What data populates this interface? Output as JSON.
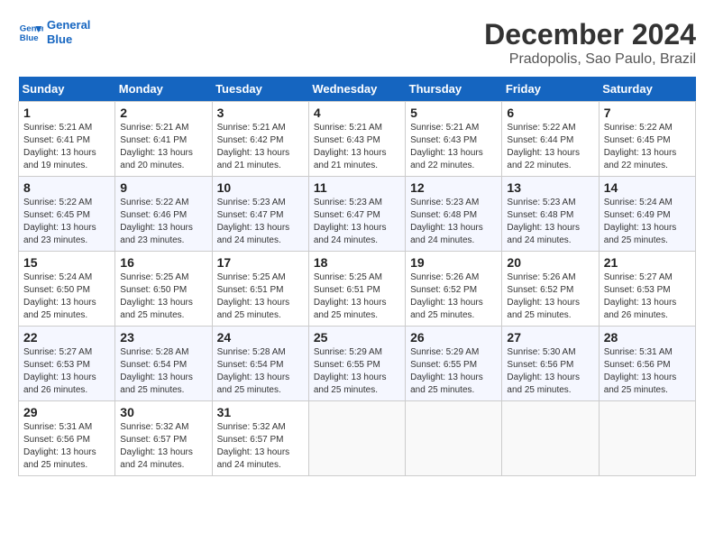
{
  "header": {
    "logo_line1": "General",
    "logo_line2": "Blue",
    "main_title": "December 2024",
    "subtitle": "Pradopolis, Sao Paulo, Brazil"
  },
  "calendar": {
    "days_of_week": [
      "Sunday",
      "Monday",
      "Tuesday",
      "Wednesday",
      "Thursday",
      "Friday",
      "Saturday"
    ],
    "weeks": [
      [
        {
          "day": "",
          "info": ""
        },
        {
          "day": "2",
          "info": "Sunrise: 5:21 AM\nSunset: 6:41 PM\nDaylight: 13 hours\nand 20 minutes."
        },
        {
          "day": "3",
          "info": "Sunrise: 5:21 AM\nSunset: 6:42 PM\nDaylight: 13 hours\nand 21 minutes."
        },
        {
          "day": "4",
          "info": "Sunrise: 5:21 AM\nSunset: 6:43 PM\nDaylight: 13 hours\nand 21 minutes."
        },
        {
          "day": "5",
          "info": "Sunrise: 5:21 AM\nSunset: 6:43 PM\nDaylight: 13 hours\nand 22 minutes."
        },
        {
          "day": "6",
          "info": "Sunrise: 5:22 AM\nSunset: 6:44 PM\nDaylight: 13 hours\nand 22 minutes."
        },
        {
          "day": "7",
          "info": "Sunrise: 5:22 AM\nSunset: 6:45 PM\nDaylight: 13 hours\nand 22 minutes."
        }
      ],
      [
        {
          "day": "1",
          "info": "Sunrise: 5:21 AM\nSunset: 6:41 PM\nDaylight: 13 hours\nand 19 minutes."
        },
        {
          "day": "",
          "info": ""
        },
        {
          "day": "",
          "info": ""
        },
        {
          "day": "",
          "info": ""
        },
        {
          "day": "",
          "info": ""
        },
        {
          "day": "",
          "info": ""
        },
        {
          "day": "",
          "info": ""
        }
      ],
      [
        {
          "day": "8",
          "info": "Sunrise: 5:22 AM\nSunset: 6:45 PM\nDaylight: 13 hours\nand 23 minutes."
        },
        {
          "day": "9",
          "info": "Sunrise: 5:22 AM\nSunset: 6:46 PM\nDaylight: 13 hours\nand 23 minutes."
        },
        {
          "day": "10",
          "info": "Sunrise: 5:23 AM\nSunset: 6:47 PM\nDaylight: 13 hours\nand 24 minutes."
        },
        {
          "day": "11",
          "info": "Sunrise: 5:23 AM\nSunset: 6:47 PM\nDaylight: 13 hours\nand 24 minutes."
        },
        {
          "day": "12",
          "info": "Sunrise: 5:23 AM\nSunset: 6:48 PM\nDaylight: 13 hours\nand 24 minutes."
        },
        {
          "day": "13",
          "info": "Sunrise: 5:23 AM\nSunset: 6:48 PM\nDaylight: 13 hours\nand 24 minutes."
        },
        {
          "day": "14",
          "info": "Sunrise: 5:24 AM\nSunset: 6:49 PM\nDaylight: 13 hours\nand 25 minutes."
        }
      ],
      [
        {
          "day": "15",
          "info": "Sunrise: 5:24 AM\nSunset: 6:50 PM\nDaylight: 13 hours\nand 25 minutes."
        },
        {
          "day": "16",
          "info": "Sunrise: 5:25 AM\nSunset: 6:50 PM\nDaylight: 13 hours\nand 25 minutes."
        },
        {
          "day": "17",
          "info": "Sunrise: 5:25 AM\nSunset: 6:51 PM\nDaylight: 13 hours\nand 25 minutes."
        },
        {
          "day": "18",
          "info": "Sunrise: 5:25 AM\nSunset: 6:51 PM\nDaylight: 13 hours\nand 25 minutes."
        },
        {
          "day": "19",
          "info": "Sunrise: 5:26 AM\nSunset: 6:52 PM\nDaylight: 13 hours\nand 25 minutes."
        },
        {
          "day": "20",
          "info": "Sunrise: 5:26 AM\nSunset: 6:52 PM\nDaylight: 13 hours\nand 25 minutes."
        },
        {
          "day": "21",
          "info": "Sunrise: 5:27 AM\nSunset: 6:53 PM\nDaylight: 13 hours\nand 26 minutes."
        }
      ],
      [
        {
          "day": "22",
          "info": "Sunrise: 5:27 AM\nSunset: 6:53 PM\nDaylight: 13 hours\nand 26 minutes."
        },
        {
          "day": "23",
          "info": "Sunrise: 5:28 AM\nSunset: 6:54 PM\nDaylight: 13 hours\nand 25 minutes."
        },
        {
          "day": "24",
          "info": "Sunrise: 5:28 AM\nSunset: 6:54 PM\nDaylight: 13 hours\nand 25 minutes."
        },
        {
          "day": "25",
          "info": "Sunrise: 5:29 AM\nSunset: 6:55 PM\nDaylight: 13 hours\nand 25 minutes."
        },
        {
          "day": "26",
          "info": "Sunrise: 5:29 AM\nSunset: 6:55 PM\nDaylight: 13 hours\nand 25 minutes."
        },
        {
          "day": "27",
          "info": "Sunrise: 5:30 AM\nSunset: 6:56 PM\nDaylight: 13 hours\nand 25 minutes."
        },
        {
          "day": "28",
          "info": "Sunrise: 5:31 AM\nSunset: 6:56 PM\nDaylight: 13 hours\nand 25 minutes."
        }
      ],
      [
        {
          "day": "29",
          "info": "Sunrise: 5:31 AM\nSunset: 6:56 PM\nDaylight: 13 hours\nand 25 minutes."
        },
        {
          "day": "30",
          "info": "Sunrise: 5:32 AM\nSunset: 6:57 PM\nDaylight: 13 hours\nand 24 minutes."
        },
        {
          "day": "31",
          "info": "Sunrise: 5:32 AM\nSunset: 6:57 PM\nDaylight: 13 hours\nand 24 minutes."
        },
        {
          "day": "",
          "info": ""
        },
        {
          "day": "",
          "info": ""
        },
        {
          "day": "",
          "info": ""
        },
        {
          "day": "",
          "info": ""
        }
      ]
    ]
  }
}
